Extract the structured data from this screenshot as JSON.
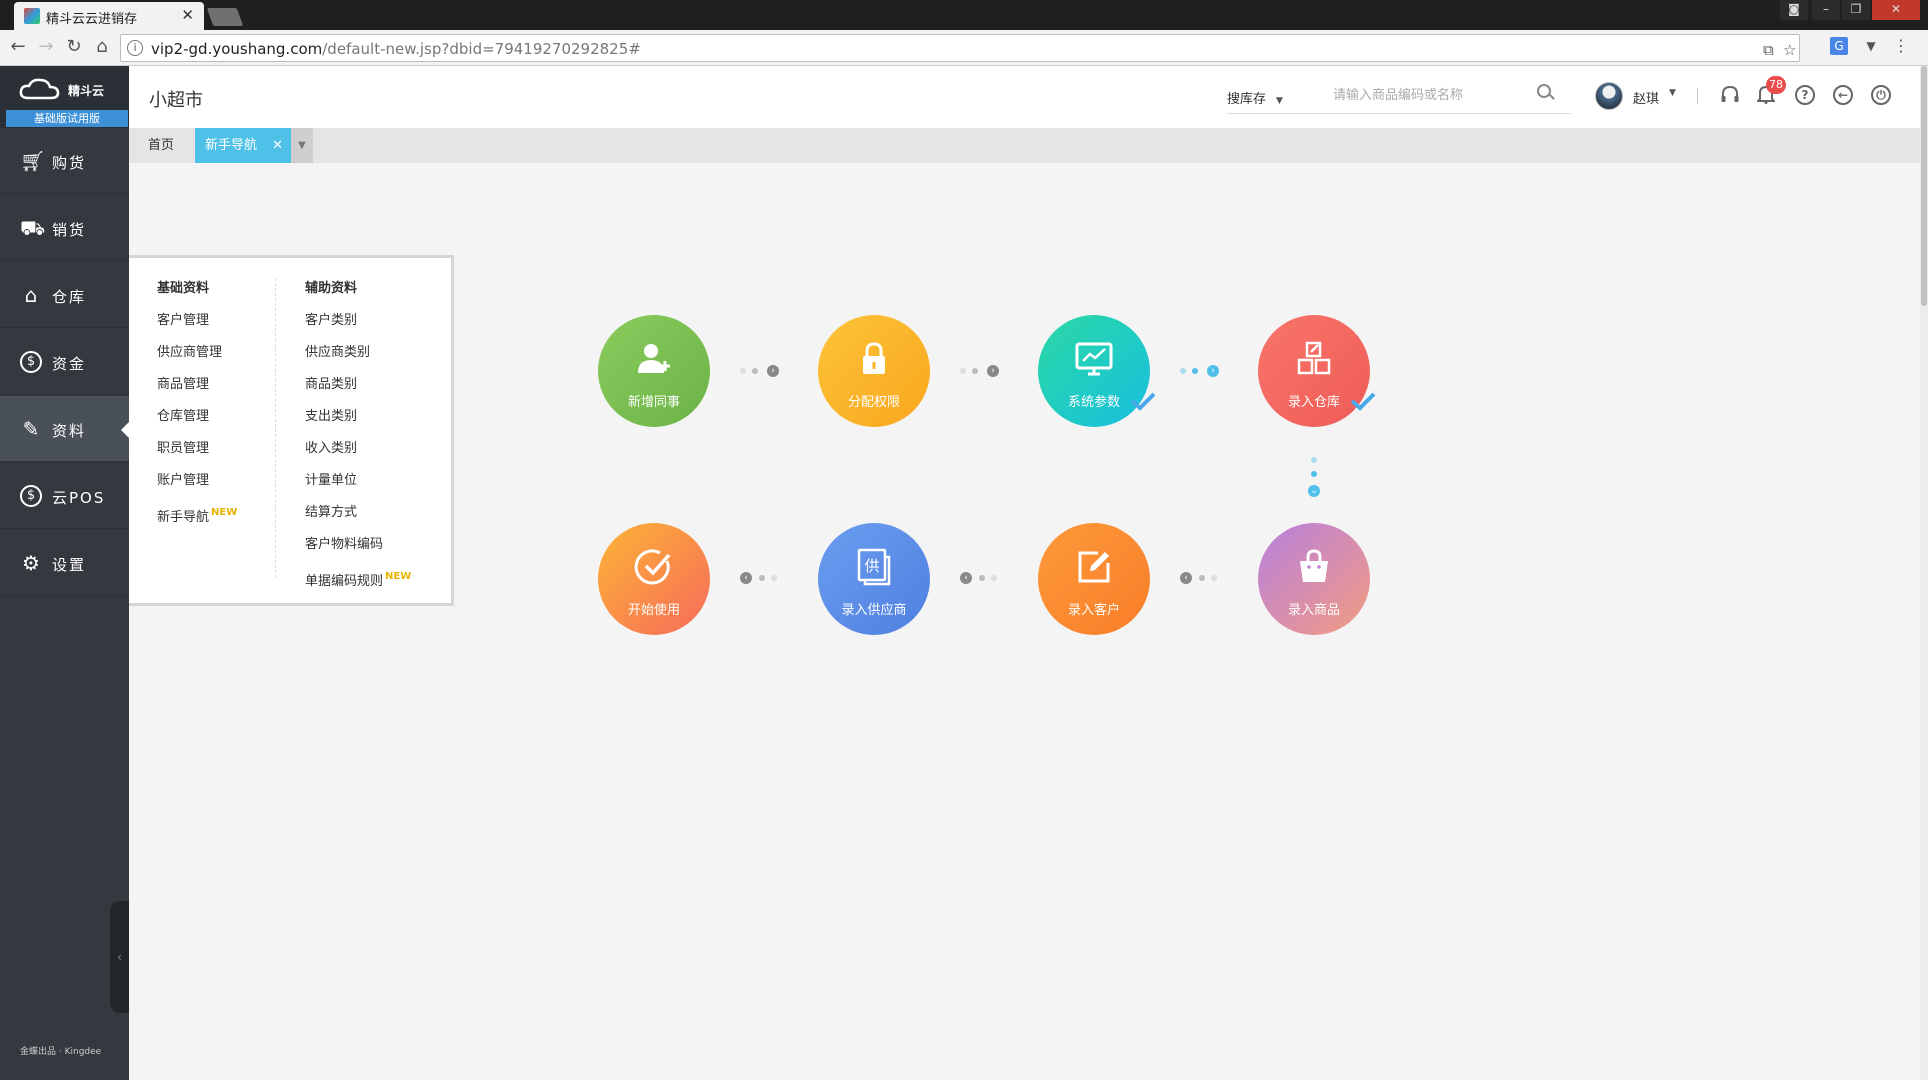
{
  "browser": {
    "tab_title": "精斗云云进销存",
    "url_host": "vip2-gd.youshang.com",
    "url_path": "/default-new.jsp?dbid=79419270292825#"
  },
  "sidebar": {
    "brand": "精斗云",
    "edition": "基础版试用版",
    "items": [
      {
        "label": "购货",
        "icon": "cart-icon"
      },
      {
        "label": "销货",
        "icon": "sales-icon"
      },
      {
        "label": "仓库",
        "icon": "warehouse-icon"
      },
      {
        "label": "资金",
        "icon": "money-icon"
      },
      {
        "label": "资料",
        "icon": "pencil-icon"
      },
      {
        "label": "云POS",
        "icon": "pos-icon"
      },
      {
        "label": "设置",
        "icon": "gear-icon"
      }
    ],
    "footer": "金蝶出品 · Kingdee"
  },
  "header": {
    "shop_name": "小超市",
    "search_scope": "搜库存",
    "search_placeholder": "请输入商品编码或名称",
    "username": "赵琪",
    "notification_count": "78"
  },
  "tabs": {
    "home": "首页",
    "active": "新手导航"
  },
  "data_menu": {
    "basic": {
      "heading": "基础资料",
      "items": [
        "客户管理",
        "供应商管理",
        "商品管理",
        "仓库管理",
        "职员管理",
        "账户管理",
        "新手导航"
      ]
    },
    "aux": {
      "heading": "辅助资料",
      "items": [
        "客户类别",
        "供应商类别",
        "商品类别",
        "支出类别",
        "收入类别",
        "计量单位",
        "结算方式",
        "客户物料编码",
        "单据编码规则"
      ]
    },
    "new_tag": "NEW"
  },
  "steps": [
    {
      "label": "新增同事",
      "color": "#7cbf52"
    },
    {
      "label": "分配权限",
      "color": "#fbb62a"
    },
    {
      "label": "系统参数",
      "color": "#1ecfbf"
    },
    {
      "label": "录入仓库",
      "color": "#f46b5e"
    },
    {
      "label": "录入商品",
      "color": "#c783d9"
    },
    {
      "label": "录入客户",
      "color": "#fb8c32"
    },
    {
      "label": "录入供应商",
      "color": "#5b8de8"
    },
    {
      "label": "开始使用",
      "color": "#fb8a45"
    }
  ]
}
